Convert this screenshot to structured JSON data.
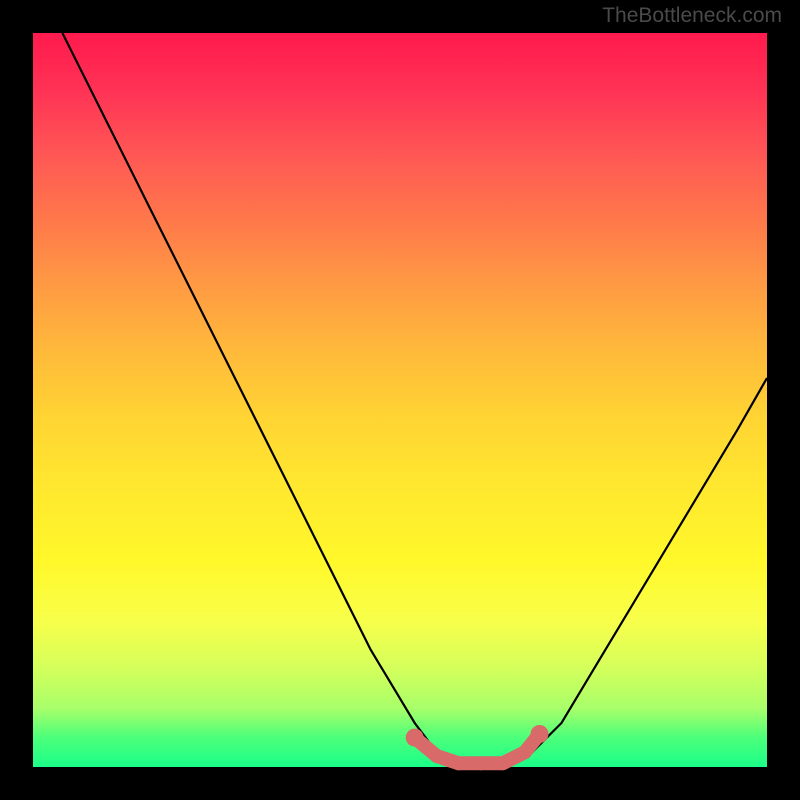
{
  "watermark": "TheBottleneck.com",
  "chart_data": {
    "type": "line",
    "title": "",
    "xlabel": "",
    "ylabel": "",
    "xlim": [
      0,
      100
    ],
    "ylim": [
      0,
      100
    ],
    "series": [
      {
        "name": "bottleneck-curve",
        "x": [
          4,
          10,
          16,
          22,
          28,
          34,
          40,
          46,
          52,
          55,
          58,
          62,
          65,
          68,
          72,
          78,
          84,
          90,
          96,
          100
        ],
        "y": [
          100,
          88,
          76,
          64,
          52,
          40,
          28,
          16,
          6,
          2,
          0.5,
          0.5,
          0.5,
          2,
          6,
          16,
          26,
          36,
          46,
          53
        ]
      }
    ],
    "highlight": {
      "name": "optimal-range",
      "color": "#d86a6a",
      "points_x": [
        52,
        55,
        58,
        61,
        64,
        67,
        69
      ],
      "points_y": [
        4,
        1.5,
        0.5,
        0.5,
        0.5,
        2,
        4.5
      ]
    }
  }
}
